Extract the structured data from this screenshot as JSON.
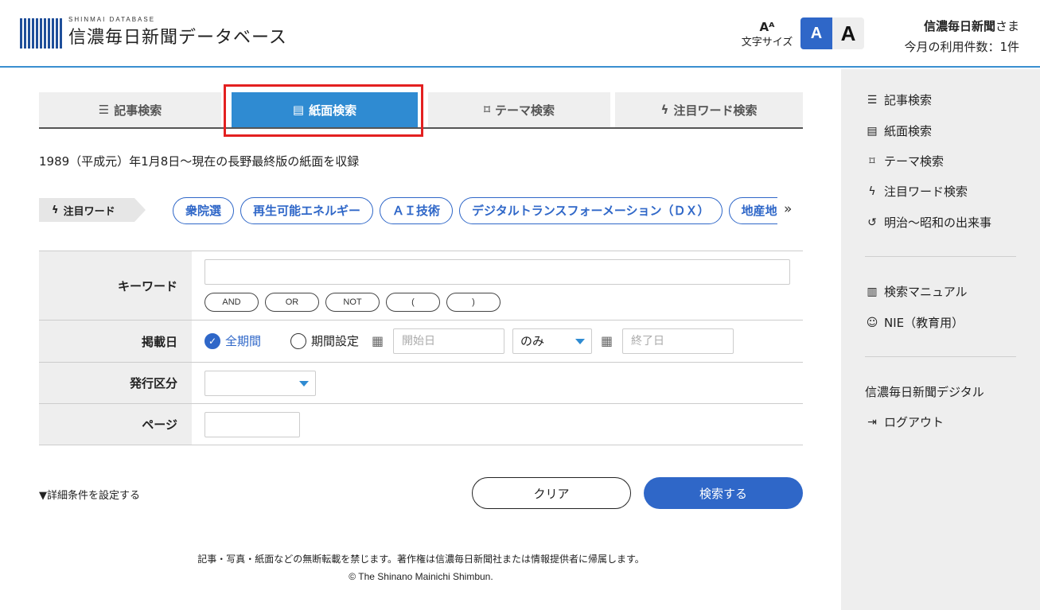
{
  "header": {
    "logo_sub": "SHINMAI DATABASE",
    "logo_title": "信濃毎日新聞データベース",
    "font_size_label": "文字サイズ",
    "font_small": "A",
    "font_large": "A",
    "user_name": "信濃毎日新聞",
    "user_suffix": "さま",
    "usage": "今月の利用件数：1件"
  },
  "tabs": [
    {
      "label": "記事検索",
      "icon": "list-icon"
    },
    {
      "label": "紙面検索",
      "icon": "newspaper-icon"
    },
    {
      "label": "テーマ検索",
      "icon": "bookmark-icon"
    },
    {
      "label": "注目ワード検索",
      "icon": "bolt-icon"
    }
  ],
  "intro": "1989（平成元）年1月8日～現在の長野最終版の紙面を収録",
  "trending": {
    "label": "注目ワード",
    "chips": [
      "衆院選",
      "再生可能エネルギー",
      "ＡＩ技術",
      "デジタルトランスフォーメーション（ＤＸ）",
      "地産地消"
    ],
    "more": "»"
  },
  "form": {
    "keyword_label": "キーワード",
    "operators": [
      "AND",
      "OR",
      "NOT",
      "(",
      ")"
    ],
    "date_label": "掲載日",
    "all_period": "全期間",
    "period_setting": "期間設定",
    "start_placeholder": "開始日",
    "range_mode": "のみ",
    "end_placeholder": "終了日",
    "edition_label": "発行区分",
    "edition_value": "",
    "page_label": "ページ"
  },
  "detail_toggle": "▼詳細条件を設定する",
  "buttons": {
    "clear": "クリア",
    "search": "検索する"
  },
  "footer": {
    "notice": "記事・写真・紙面などの無断転載を禁じます。著作権は信濃毎日新聞社または情報提供者に帰属します。",
    "copyright": "© The Shinano Mainichi Shimbun."
  },
  "sidebar": {
    "group1": [
      {
        "label": "記事検索",
        "icon": "list-icon"
      },
      {
        "label": "紙面検索",
        "icon": "newspaper-icon"
      },
      {
        "label": "テーマ検索",
        "icon": "bookmark-icon"
      },
      {
        "label": "注目ワード検索",
        "icon": "bolt-icon"
      },
      {
        "label": "明治～昭和の出来事",
        "icon": "history-icon"
      }
    ],
    "group2": [
      {
        "label": "検索マニュアル",
        "icon": "book-icon"
      },
      {
        "label": "NIE（教育用）",
        "icon": "smile-icon"
      }
    ],
    "group3": [
      {
        "label": "信濃毎日新聞デジタル"
      },
      {
        "label": "ログアウト",
        "icon": "logout-icon"
      }
    ]
  },
  "colors": {
    "accent": "#2f8bd2",
    "primary": "#2f67c8",
    "highlight": "#e32020"
  }
}
